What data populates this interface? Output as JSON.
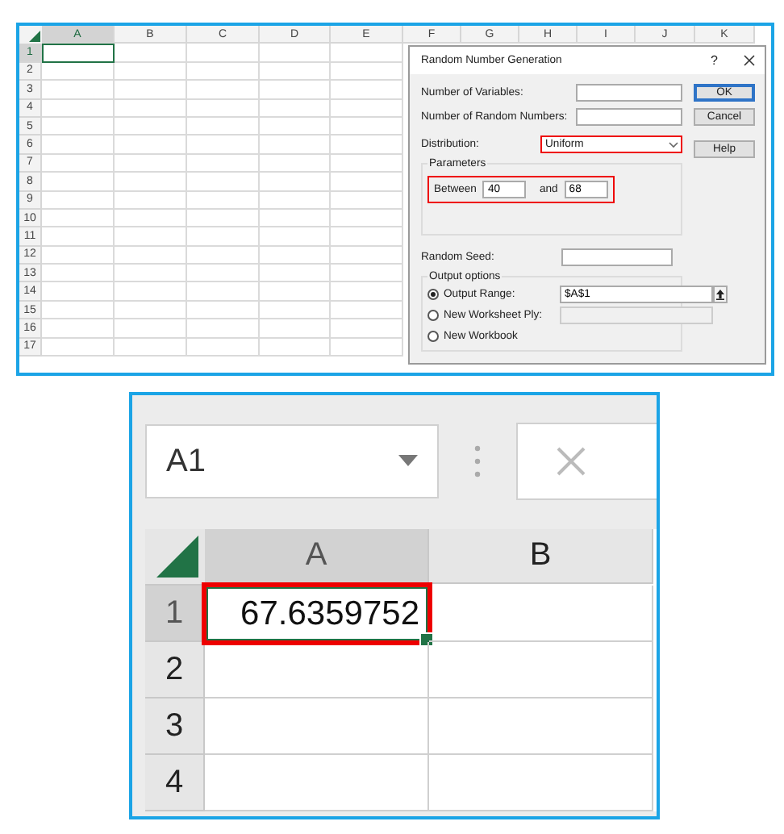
{
  "sheet": {
    "columns": [
      {
        "label": "A",
        "selected": true
      },
      {
        "label": "B",
        "selected": false
      },
      {
        "label": "C",
        "selected": false
      },
      {
        "label": "D",
        "selected": false
      },
      {
        "label": "E",
        "selected": false
      },
      {
        "label": "F",
        "selected": false
      },
      {
        "label": "G",
        "selected": false
      },
      {
        "label": "H",
        "selected": false
      },
      {
        "label": "I",
        "selected": false
      },
      {
        "label": "J",
        "selected": false
      },
      {
        "label": "K",
        "selected": false
      }
    ],
    "rows": [
      {
        "label": "1",
        "selected": true
      },
      {
        "label": "2",
        "selected": false
      },
      {
        "label": "3",
        "selected": false
      },
      {
        "label": "4",
        "selected": false
      },
      {
        "label": "5",
        "selected": false
      },
      {
        "label": "6",
        "selected": false
      },
      {
        "label": "7",
        "selected": false
      },
      {
        "label": "8",
        "selected": false
      },
      {
        "label": "9",
        "selected": false
      },
      {
        "label": "10",
        "selected": false
      },
      {
        "label": "11",
        "selected": false
      },
      {
        "label": "12",
        "selected": false
      },
      {
        "label": "13",
        "selected": false
      },
      {
        "label": "14",
        "selected": false
      },
      {
        "label": "15",
        "selected": false
      },
      {
        "label": "16",
        "selected": false
      },
      {
        "label": "17",
        "selected": false
      }
    ]
  },
  "dialog": {
    "title": "Random Number Generation",
    "help": "?",
    "inputs": [
      {
        "label": "Number of Variables:"
      },
      {
        "label": "Number of Random Numbers:"
      }
    ],
    "distribution": {
      "label": "Distribution:",
      "value": "Uniform",
      "highlighted": true
    },
    "parameters": {
      "title": "Parameters",
      "highlighted": true,
      "fields": [
        {
          "label": "Between",
          "value": "40"
        },
        {
          "label": "and",
          "value": "68"
        }
      ]
    },
    "seed": {
      "label": "Random Seed:"
    },
    "output": {
      "title": "Output options",
      "options": [
        {
          "label": "Output Range:",
          "selected": true,
          "field": {
            "value": "$A$1",
            "disabled": false,
            "picker": true
          }
        },
        {
          "label": "New Worksheet Ply:",
          "selected": false,
          "field": {
            "disabled": true,
            "picker": false
          }
        },
        {
          "label": "New Workbook",
          "selected": false
        }
      ]
    },
    "buttons": [
      {
        "label": "OK",
        "default": true
      },
      {
        "label": "Cancel",
        "default": false
      },
      {
        "label": "Help",
        "default": false
      }
    ]
  },
  "zoom": {
    "name_box": "A1",
    "columns": [
      {
        "label": "A",
        "selected": true
      },
      {
        "label": "B",
        "selected": false
      }
    ],
    "rows": [
      {
        "label": "1",
        "selected": true,
        "value": "67.6359752",
        "highlighted": true
      },
      {
        "label": "2",
        "selected": false,
        "highlighted": false
      },
      {
        "label": "3",
        "selected": false,
        "highlighted": false
      },
      {
        "label": "4",
        "selected": false,
        "highlighted": false
      }
    ]
  }
}
